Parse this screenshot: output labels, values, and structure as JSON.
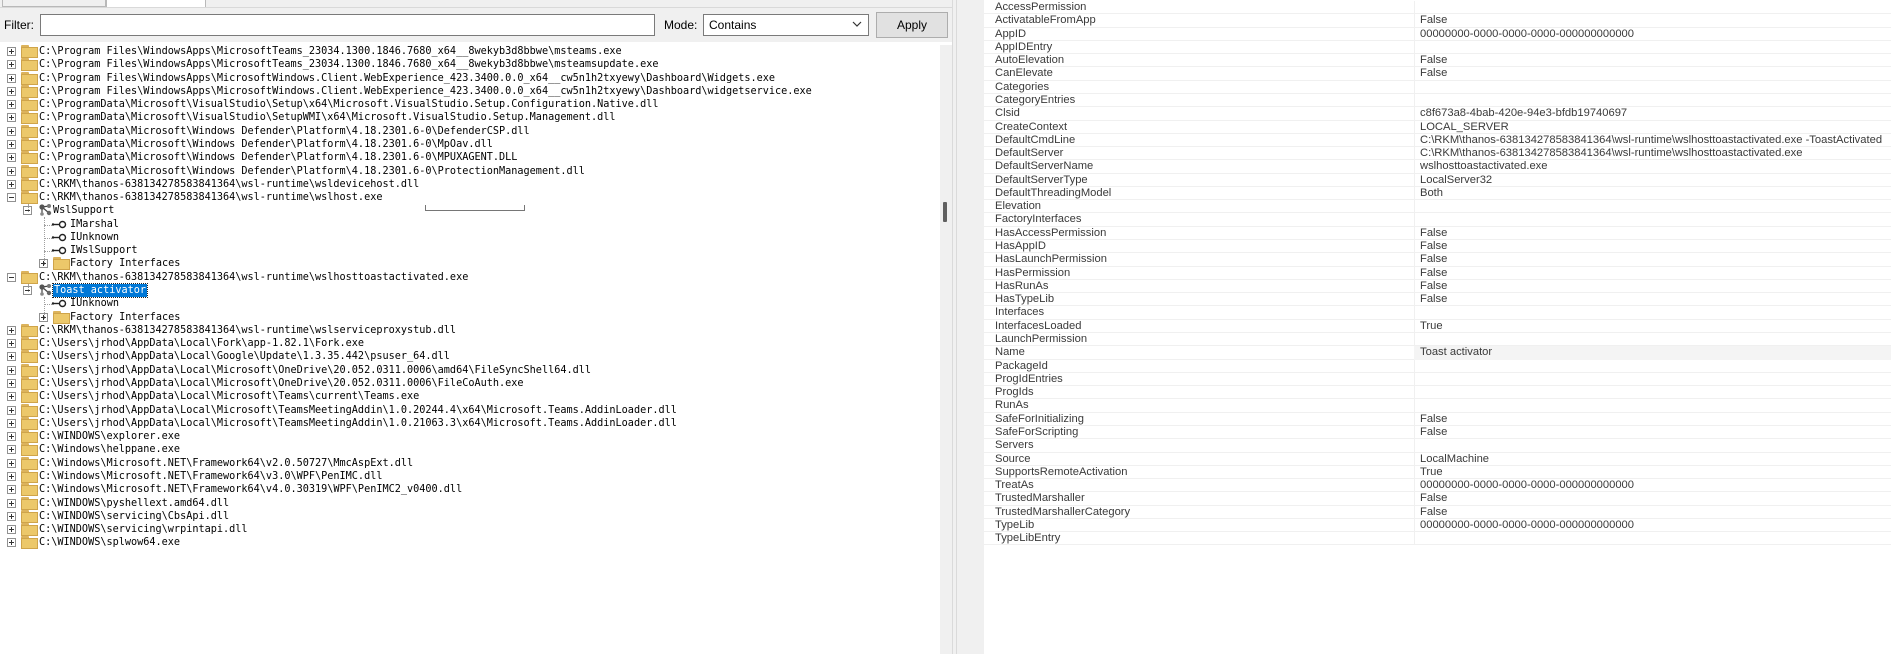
{
  "filterbar": {
    "filter_label": "Filter:",
    "filter_value": "",
    "mode_label": "Mode:",
    "mode_value": "Contains",
    "apply_label": "Apply"
  },
  "tree": {
    "rows": [
      {
        "text": "C:\\Program Files\\WindowsApps\\MicrosoftTeams_23034.1300.1846.7680_x64__8wekyb3d8bbwe\\msteams.exe",
        "level": 0,
        "expander": "plus",
        "icon": "folder"
      },
      {
        "text": "C:\\Program Files\\WindowsApps\\MicrosoftTeams_23034.1300.1846.7680_x64__8wekyb3d8bbwe\\msteamsupdate.exe",
        "level": 0,
        "expander": "plus",
        "icon": "folder"
      },
      {
        "text": "C:\\Program Files\\WindowsApps\\MicrosoftWindows.Client.WebExperience_423.3400.0.0_x64__cw5n1h2txyewy\\Dashboard\\Widgets.exe",
        "level": 0,
        "expander": "plus",
        "icon": "folder"
      },
      {
        "text": "C:\\Program Files\\WindowsApps\\MicrosoftWindows.Client.WebExperience_423.3400.0.0_x64__cw5n1h2txyewy\\Dashboard\\widgetservice.exe",
        "level": 0,
        "expander": "plus",
        "icon": "folder"
      },
      {
        "text": "C:\\ProgramData\\Microsoft\\VisualStudio\\Setup\\x64\\Microsoft.VisualStudio.Setup.Configuration.Native.dll",
        "level": 0,
        "expander": "plus",
        "icon": "folder"
      },
      {
        "text": "C:\\ProgramData\\Microsoft\\VisualStudio\\SetupWMI\\x64\\Microsoft.VisualStudio.Setup.Management.dll",
        "level": 0,
        "expander": "plus",
        "icon": "folder"
      },
      {
        "text": "C:\\ProgramData\\Microsoft\\Windows Defender\\Platform\\4.18.2301.6-0\\DefenderCSP.dll",
        "level": 0,
        "expander": "plus",
        "icon": "folder"
      },
      {
        "text": "C:\\ProgramData\\Microsoft\\Windows Defender\\Platform\\4.18.2301.6-0\\MpOav.dll",
        "level": 0,
        "expander": "plus",
        "icon": "folder"
      },
      {
        "text": "C:\\ProgramData\\Microsoft\\Windows Defender\\Platform\\4.18.2301.6-0\\MPUXAGENT.DLL",
        "level": 0,
        "expander": "plus",
        "icon": "folder"
      },
      {
        "text": "C:\\ProgramData\\Microsoft\\Windows Defender\\Platform\\4.18.2301.6-0\\ProtectionManagement.dll",
        "level": 0,
        "expander": "plus",
        "icon": "folder"
      },
      {
        "text": "C:\\RKM\\thanos-638134278583841364\\wsl-runtime\\wsldevicehost.dll",
        "level": 0,
        "expander": "plus",
        "icon": "folder"
      },
      {
        "text": "C:\\RKM\\thanos-638134278583841364\\wsl-runtime\\wslhost.exe",
        "level": 0,
        "expander": "minus",
        "icon": "folder"
      },
      {
        "text": "WslSupport",
        "level": 1,
        "expander": "minus",
        "icon": "class"
      },
      {
        "text": "IMarshal",
        "level": 2,
        "expander": "none",
        "icon": "interface"
      },
      {
        "text": "IUnknown",
        "level": 2,
        "expander": "none",
        "icon": "interface"
      },
      {
        "text": "IWslSupport",
        "level": 2,
        "expander": "none",
        "icon": "interface"
      },
      {
        "text": "Factory Interfaces",
        "level": 2,
        "expander": "plus",
        "icon": "folder"
      },
      {
        "text": "C:\\RKM\\thanos-638134278583841364\\wsl-runtime\\wslhosttoastactivated.exe",
        "level": 0,
        "expander": "minus",
        "icon": "folder"
      },
      {
        "text": "Toast activator",
        "level": 1,
        "expander": "minus",
        "icon": "class",
        "selected": true
      },
      {
        "text": "IUnknown",
        "level": 2,
        "expander": "none",
        "icon": "interface"
      },
      {
        "text": "Factory Interfaces",
        "level": 2,
        "expander": "plus",
        "icon": "folder"
      },
      {
        "text": "C:\\RKM\\thanos-638134278583841364\\wsl-runtime\\wslserviceproxystub.dll",
        "level": 0,
        "expander": "plus",
        "icon": "folder"
      },
      {
        "text": "C:\\Users\\jrhod\\AppData\\Local\\Fork\\app-1.82.1\\Fork.exe",
        "level": 0,
        "expander": "plus",
        "icon": "folder"
      },
      {
        "text": "C:\\Users\\jrhod\\AppData\\Local\\Google\\Update\\1.3.35.442\\psuser_64.dll",
        "level": 0,
        "expander": "plus",
        "icon": "folder"
      },
      {
        "text": "C:\\Users\\jrhod\\AppData\\Local\\Microsoft\\OneDrive\\20.052.0311.0006\\amd64\\FileSyncShell64.dll",
        "level": 0,
        "expander": "plus",
        "icon": "folder"
      },
      {
        "text": "C:\\Users\\jrhod\\AppData\\Local\\Microsoft\\OneDrive\\20.052.0311.0006\\FileCoAuth.exe",
        "level": 0,
        "expander": "plus",
        "icon": "folder"
      },
      {
        "text": "C:\\Users\\jrhod\\AppData\\Local\\Microsoft\\Teams\\current\\Teams.exe",
        "level": 0,
        "expander": "plus",
        "icon": "folder"
      },
      {
        "text": "C:\\Users\\jrhod\\AppData\\Local\\Microsoft\\TeamsMeetingAddin\\1.0.20244.4\\x64\\Microsoft.Teams.AddinLoader.dll",
        "level": 0,
        "expander": "plus",
        "icon": "folder"
      },
      {
        "text": "C:\\Users\\jrhod\\AppData\\Local\\Microsoft\\TeamsMeetingAddin\\1.0.21063.3\\x64\\Microsoft.Teams.AddinLoader.dll",
        "level": 0,
        "expander": "plus",
        "icon": "folder"
      },
      {
        "text": "C:\\WINDOWS\\explorer.exe",
        "level": 0,
        "expander": "plus",
        "icon": "folder"
      },
      {
        "text": "C:\\Windows\\helppane.exe",
        "level": 0,
        "expander": "plus",
        "icon": "folder"
      },
      {
        "text": "C:\\Windows\\Microsoft.NET\\Framework64\\v2.0.50727\\MmcAspExt.dll",
        "level": 0,
        "expander": "plus",
        "icon": "folder"
      },
      {
        "text": "C:\\Windows\\Microsoft.NET\\Framework64\\v3.0\\WPF\\PenIMC.dll",
        "level": 0,
        "expander": "plus",
        "icon": "folder"
      },
      {
        "text": "C:\\Windows\\Microsoft.NET\\Framework64\\v4.0.30319\\WPF\\PenIMC2_v0400.dll",
        "level": 0,
        "expander": "plus",
        "icon": "folder"
      },
      {
        "text": "C:\\WINDOWS\\pyshellext.amd64.dll",
        "level": 0,
        "expander": "plus",
        "icon": "folder"
      },
      {
        "text": "C:\\WINDOWS\\servicing\\CbsApi.dll",
        "level": 0,
        "expander": "plus",
        "icon": "folder"
      },
      {
        "text": "C:\\WINDOWS\\servicing\\wrpintapi.dll",
        "level": 0,
        "expander": "plus",
        "icon": "folder"
      },
      {
        "text": "C:\\WINDOWS\\splwow64.exe",
        "level": 0,
        "expander": "plus",
        "icon": "folder"
      }
    ]
  },
  "properties": {
    "rows": [
      {
        "name": "AccessPermission",
        "value": ""
      },
      {
        "name": "ActivatableFromApp",
        "value": "False"
      },
      {
        "name": "AppID",
        "value": "00000000-0000-0000-0000-000000000000"
      },
      {
        "name": "AppIDEntry",
        "value": ""
      },
      {
        "name": "AutoElevation",
        "value": "False"
      },
      {
        "name": "CanElevate",
        "value": "False"
      },
      {
        "name": "Categories",
        "value": ""
      },
      {
        "name": "CategoryEntries",
        "value": ""
      },
      {
        "name": "Clsid",
        "value": "c8f673a8-4bab-420e-94e3-bfdb19740697"
      },
      {
        "name": "CreateContext",
        "value": "LOCAL_SERVER"
      },
      {
        "name": "DefaultCmdLine",
        "value": "C:\\RKM\\thanos-638134278583841364\\wsl-runtime\\wslhosttoastactivated.exe -ToastActivated"
      },
      {
        "name": "DefaultServer",
        "value": "C:\\RKM\\thanos-638134278583841364\\wsl-runtime\\wslhosttoastactivated.exe"
      },
      {
        "name": "DefaultServerName",
        "value": "wslhosttoastactivated.exe"
      },
      {
        "name": "DefaultServerType",
        "value": "LocalServer32"
      },
      {
        "name": "DefaultThreadingModel",
        "value": "Both"
      },
      {
        "name": "Elevation",
        "value": ""
      },
      {
        "name": "FactoryInterfaces",
        "value": ""
      },
      {
        "name": "HasAccessPermission",
        "value": "False"
      },
      {
        "name": "HasAppID",
        "value": "False"
      },
      {
        "name": "HasLaunchPermission",
        "value": "False"
      },
      {
        "name": "HasPermission",
        "value": "False"
      },
      {
        "name": "HasRunAs",
        "value": "False"
      },
      {
        "name": "HasTypeLib",
        "value": "False"
      },
      {
        "name": "Interfaces",
        "value": ""
      },
      {
        "name": "InterfacesLoaded",
        "value": "True"
      },
      {
        "name": "LaunchPermission",
        "value": ""
      },
      {
        "name": "Name",
        "value": "Toast activator",
        "highlight": true
      },
      {
        "name": "PackageId",
        "value": ""
      },
      {
        "name": "ProgIdEntries",
        "value": ""
      },
      {
        "name": "ProgIds",
        "value": ""
      },
      {
        "name": "RunAs",
        "value": ""
      },
      {
        "name": "SafeForInitializing",
        "value": "False"
      },
      {
        "name": "SafeForScripting",
        "value": "False"
      },
      {
        "name": "Servers",
        "value": ""
      },
      {
        "name": "Source",
        "value": "LocalMachine"
      },
      {
        "name": "SupportsRemoteActivation",
        "value": "True"
      },
      {
        "name": "TreatAs",
        "value": "00000000-0000-0000-0000-000000000000"
      },
      {
        "name": "TrustedMarshaller",
        "value": "False"
      },
      {
        "name": "TrustedMarshallerCategory",
        "value": "False"
      },
      {
        "name": "TypeLib",
        "value": "00000000-0000-0000-0000-000000000000"
      },
      {
        "name": "TypeLibEntry",
        "value": ""
      }
    ]
  },
  "colors": {
    "selection": "#0078d7",
    "folder": "#ecc86a",
    "panel": "#f0f0f0"
  }
}
